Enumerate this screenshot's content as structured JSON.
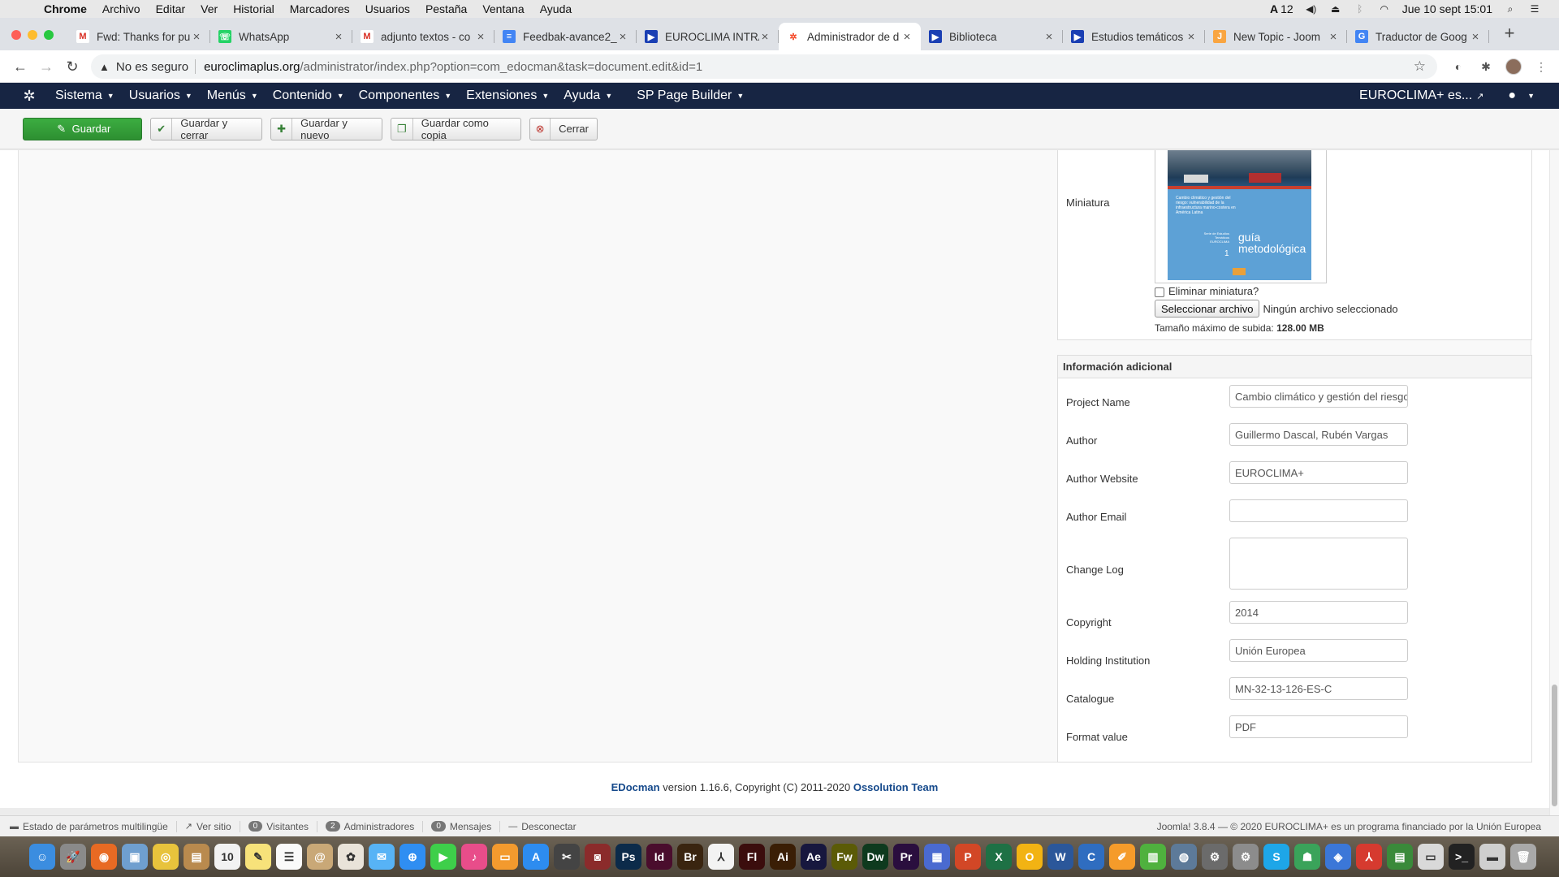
{
  "mac_menubar": {
    "app": "Chrome",
    "items": [
      "Archivo",
      "Editar",
      "Ver",
      "Historial",
      "Marcadores",
      "Usuarios",
      "Pestaña",
      "Ventana",
      "Ayuda"
    ],
    "status_num": "12",
    "datetime": "Jue 10 sept  15:01"
  },
  "tabs": [
    {
      "title": "Fwd: Thanks for pu",
      "icon": "gmail-icon",
      "active": false
    },
    {
      "title": "WhatsApp",
      "icon": "whatsapp-icon",
      "active": false
    },
    {
      "title": "adjunto textos - co",
      "icon": "gmail-icon",
      "active": false
    },
    {
      "title": "Feedbak-avance2_",
      "icon": "docs-icon",
      "active": false
    },
    {
      "title": "EUROCLIMA INTRA",
      "icon": "euroclima-icon",
      "active": false
    },
    {
      "title": "Administrador de d",
      "icon": "joomla-icon",
      "active": true
    },
    {
      "title": "Biblioteca",
      "icon": "euroclima-icon",
      "active": false
    },
    {
      "title": "Estudios temáticos",
      "icon": "euroclima-icon",
      "active": false
    },
    {
      "title": "New Topic - Joom",
      "icon": "joomla-forum-icon",
      "active": false
    },
    {
      "title": "Traductor de Goog",
      "icon": "translate-icon",
      "active": false
    }
  ],
  "omnibox": {
    "security_text": "No es seguro",
    "host": "euroclimaplus.org",
    "path": "/administrator/index.php?option=com_edocman&task=document.edit&id=1"
  },
  "joomla_nav": {
    "items": [
      "Sistema",
      "Usuarios",
      "Menús",
      "Contenido",
      "Componentes",
      "Extensiones",
      "Ayuda",
      "SP Page Builder"
    ],
    "site_link": "EUROCLIMA+ es..."
  },
  "toolbar": {
    "save": "Guardar",
    "save_close": "Guardar y cerrar",
    "save_new": "Guardar y nuevo",
    "save_copy": "Guardar como copia",
    "close": "Cerrar"
  },
  "thumbnail": {
    "label": "Miniatura",
    "cover_title": "Cambio climático y gestión del riesgo: vulnerabilidad de la infraestructura marino-costera en América Latina",
    "cover_series": "Serie de Estudios Temáticos EUROCLIMA",
    "cover_number": "1",
    "cover_guide": "guía metodológica",
    "delete_label": "Eliminar miniatura?",
    "select_button": "Seleccionar archivo",
    "no_file": "Ningún archivo seleccionado",
    "max_upload_label": "Tamaño máximo de subida:",
    "max_upload_value": "128.00 MB"
  },
  "additional_info": {
    "heading": "Información adicional",
    "fields": [
      {
        "label": "Project Name",
        "value": "Cambio climático y gestión del riesgo"
      },
      {
        "label": "Author",
        "value": "Guillermo Dascal, Rubén Vargas"
      },
      {
        "label": "Author Website",
        "value": "EUROCLIMA+"
      },
      {
        "label": "Author Email",
        "value": ""
      },
      {
        "label": "Change Log",
        "value": ""
      },
      {
        "label": "Copyright",
        "value": "2014"
      },
      {
        "label": "Holding Institution",
        "value": "Unión Europea"
      },
      {
        "label": "Catalogue",
        "value": "MN-32-13-126-ES-C"
      },
      {
        "label": "Format value",
        "value": "PDF"
      }
    ]
  },
  "footer_credit": {
    "product": "EDocman",
    "text": " version 1.16.6, Copyright (C) 2011-2020 ",
    "team": "Ossolution Team"
  },
  "status_bar": {
    "multilang": "Estado de parámetros multilingüe",
    "view_site": "Ver sitio",
    "visitors_count": "0",
    "visitors": "Visitantes",
    "admins_count": "2",
    "admins": "Administradores",
    "messages_count": "0",
    "messages": "Mensajes",
    "logout": "Desconectar",
    "right": "Joomla! 3.8.4  —  © 2020 EUROCLIMA+ es un programa financiado por la Unión Europea"
  },
  "dock_apps": [
    {
      "name": "finder",
      "glyph": "☺",
      "color": "#3b8de0"
    },
    {
      "name": "launchpad",
      "glyph": "🚀",
      "color": "#8a8a8a"
    },
    {
      "name": "firefox",
      "glyph": "◉",
      "color": "#e86a23"
    },
    {
      "name": "preview",
      "glyph": "▣",
      "color": "#6f9fcf"
    },
    {
      "name": "chrome",
      "glyph": "◎",
      "color": "#e8c33c"
    },
    {
      "name": "notebook",
      "glyph": "▤",
      "color": "#b98a4e"
    },
    {
      "name": "calendar",
      "glyph": "10",
      "color": "#f2f2f2"
    },
    {
      "name": "notes",
      "glyph": "✎",
      "color": "#f7e27a"
    },
    {
      "name": "reminders",
      "glyph": "☰",
      "color": "#fafafa"
    },
    {
      "name": "contacts",
      "glyph": "@",
      "color": "#c9a877"
    },
    {
      "name": "photos",
      "glyph": "✿",
      "color": "#e9e3d9"
    },
    {
      "name": "messages",
      "glyph": "✉",
      "color": "#57b3f6"
    },
    {
      "name": "safari",
      "glyph": "⊕",
      "color": "#2f8ef2"
    },
    {
      "name": "facetime",
      "glyph": "▶",
      "color": "#3ecf4a"
    },
    {
      "name": "itunes",
      "glyph": "♪",
      "color": "#e84d8a"
    },
    {
      "name": "books",
      "glyph": "▭",
      "color": "#f39a2e"
    },
    {
      "name": "app-store",
      "glyph": "A",
      "color": "#2d8cf0"
    },
    {
      "name": "final-cut",
      "glyph": "✂",
      "color": "#444"
    },
    {
      "name": "photo-booth",
      "glyph": "◙",
      "color": "#8b2b2b"
    },
    {
      "name": "photoshop",
      "glyph": "Ps",
      "color": "#0c2b4a"
    },
    {
      "name": "indesign",
      "glyph": "Id",
      "color": "#4a0d2d"
    },
    {
      "name": "bridge",
      "glyph": "Br",
      "color": "#3a2510"
    },
    {
      "name": "acrobat",
      "glyph": "⅄",
      "color": "#f3f3f3"
    },
    {
      "name": "flash",
      "glyph": "Fl",
      "color": "#3b0d0d"
    },
    {
      "name": "illustrator",
      "glyph": "Ai",
      "color": "#3a1e05"
    },
    {
      "name": "after-effects",
      "glyph": "Ae",
      "color": "#17173e"
    },
    {
      "name": "fireworks",
      "glyph": "Fw",
      "color": "#5b5b07"
    },
    {
      "name": "dreamweaver",
      "glyph": "Dw",
      "color": "#0e3a1e"
    },
    {
      "name": "premiere",
      "glyph": "Pr",
      "color": "#2a0e3e"
    },
    {
      "name": "keynote",
      "glyph": "▦",
      "color": "#4a6ad0"
    },
    {
      "name": "powerpoint",
      "glyph": "P",
      "color": "#d24726"
    },
    {
      "name": "excel",
      "glyph": "X",
      "color": "#1e7145"
    },
    {
      "name": "outlook",
      "glyph": "O",
      "color": "#f2b313"
    },
    {
      "name": "word",
      "glyph": "W",
      "color": "#2b579a"
    },
    {
      "name": "connect",
      "glyph": "C",
      "color": "#2f6dc0"
    },
    {
      "name": "pages",
      "glyph": "✐",
      "color": "#f59b2a"
    },
    {
      "name": "numbers",
      "glyph": "▥",
      "color": "#4fb13e"
    },
    {
      "name": "network",
      "glyph": "◍",
      "color": "#5d7a99"
    },
    {
      "name": "migration",
      "glyph": "⚙",
      "color": "#6b6b6b"
    },
    {
      "name": "system-prefs",
      "glyph": "⚙",
      "color": "#8c8c8c"
    },
    {
      "name": "skype",
      "glyph": "S",
      "color": "#1ea6e8"
    },
    {
      "name": "teams",
      "glyph": "☗",
      "color": "#3aa35a"
    },
    {
      "name": "vpn",
      "glyph": "◈",
      "color": "#3b77d8"
    },
    {
      "name": "acrobat-reader",
      "glyph": "⅄",
      "color": "#d63a2f"
    },
    {
      "name": "folder-green",
      "glyph": "▤",
      "color": "#3a8a3a"
    },
    {
      "name": "documents",
      "glyph": "▭",
      "color": "#d9d9d9"
    },
    {
      "name": "terminal",
      "glyph": ">_",
      "color": "#222"
    },
    {
      "name": "downloads",
      "glyph": "▬",
      "color": "#cfcfcf"
    },
    {
      "name": "trash",
      "glyph": "🗑",
      "color": "#a9a9a9"
    }
  ]
}
